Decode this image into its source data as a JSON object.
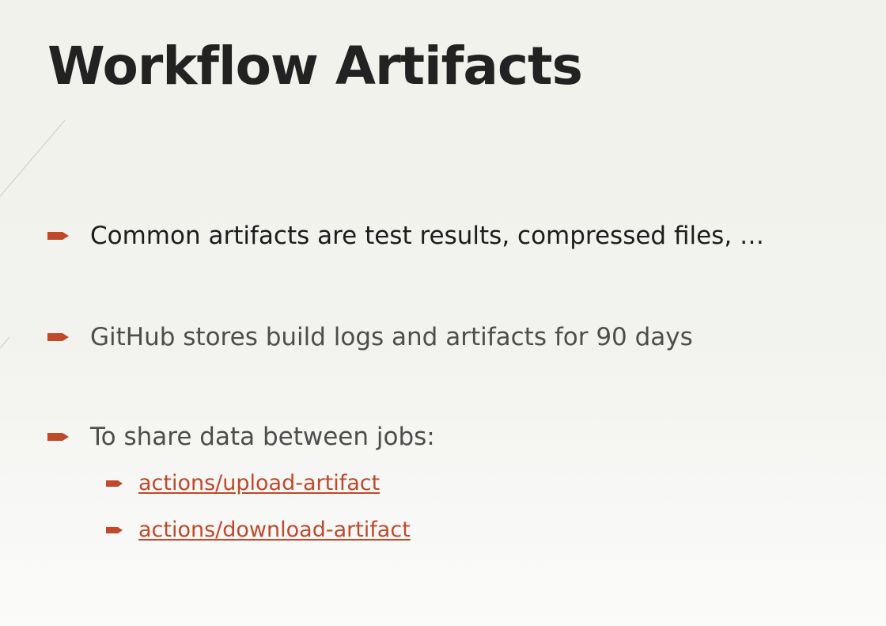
{
  "slide": {
    "title": "Workflow Artifacts",
    "bullets": [
      {
        "text": "Common artifacts are test results, compressed files, …"
      },
      {
        "text": "GitHub stores build logs and artifacts for 90 days"
      },
      {
        "text": "To share data between jobs:"
      }
    ],
    "sub_bullets": [
      {
        "text": "actions/upload-artifact"
      },
      {
        "text": "actions/download-artifact"
      }
    ]
  },
  "icons": {
    "bullet": "arrow-bullet-icon"
  },
  "colors": {
    "background": "#f1f2ec",
    "title": "#222222",
    "text": "#1d1d1d",
    "muted_text": "#4d4d4d",
    "accent": "#c0482b"
  }
}
